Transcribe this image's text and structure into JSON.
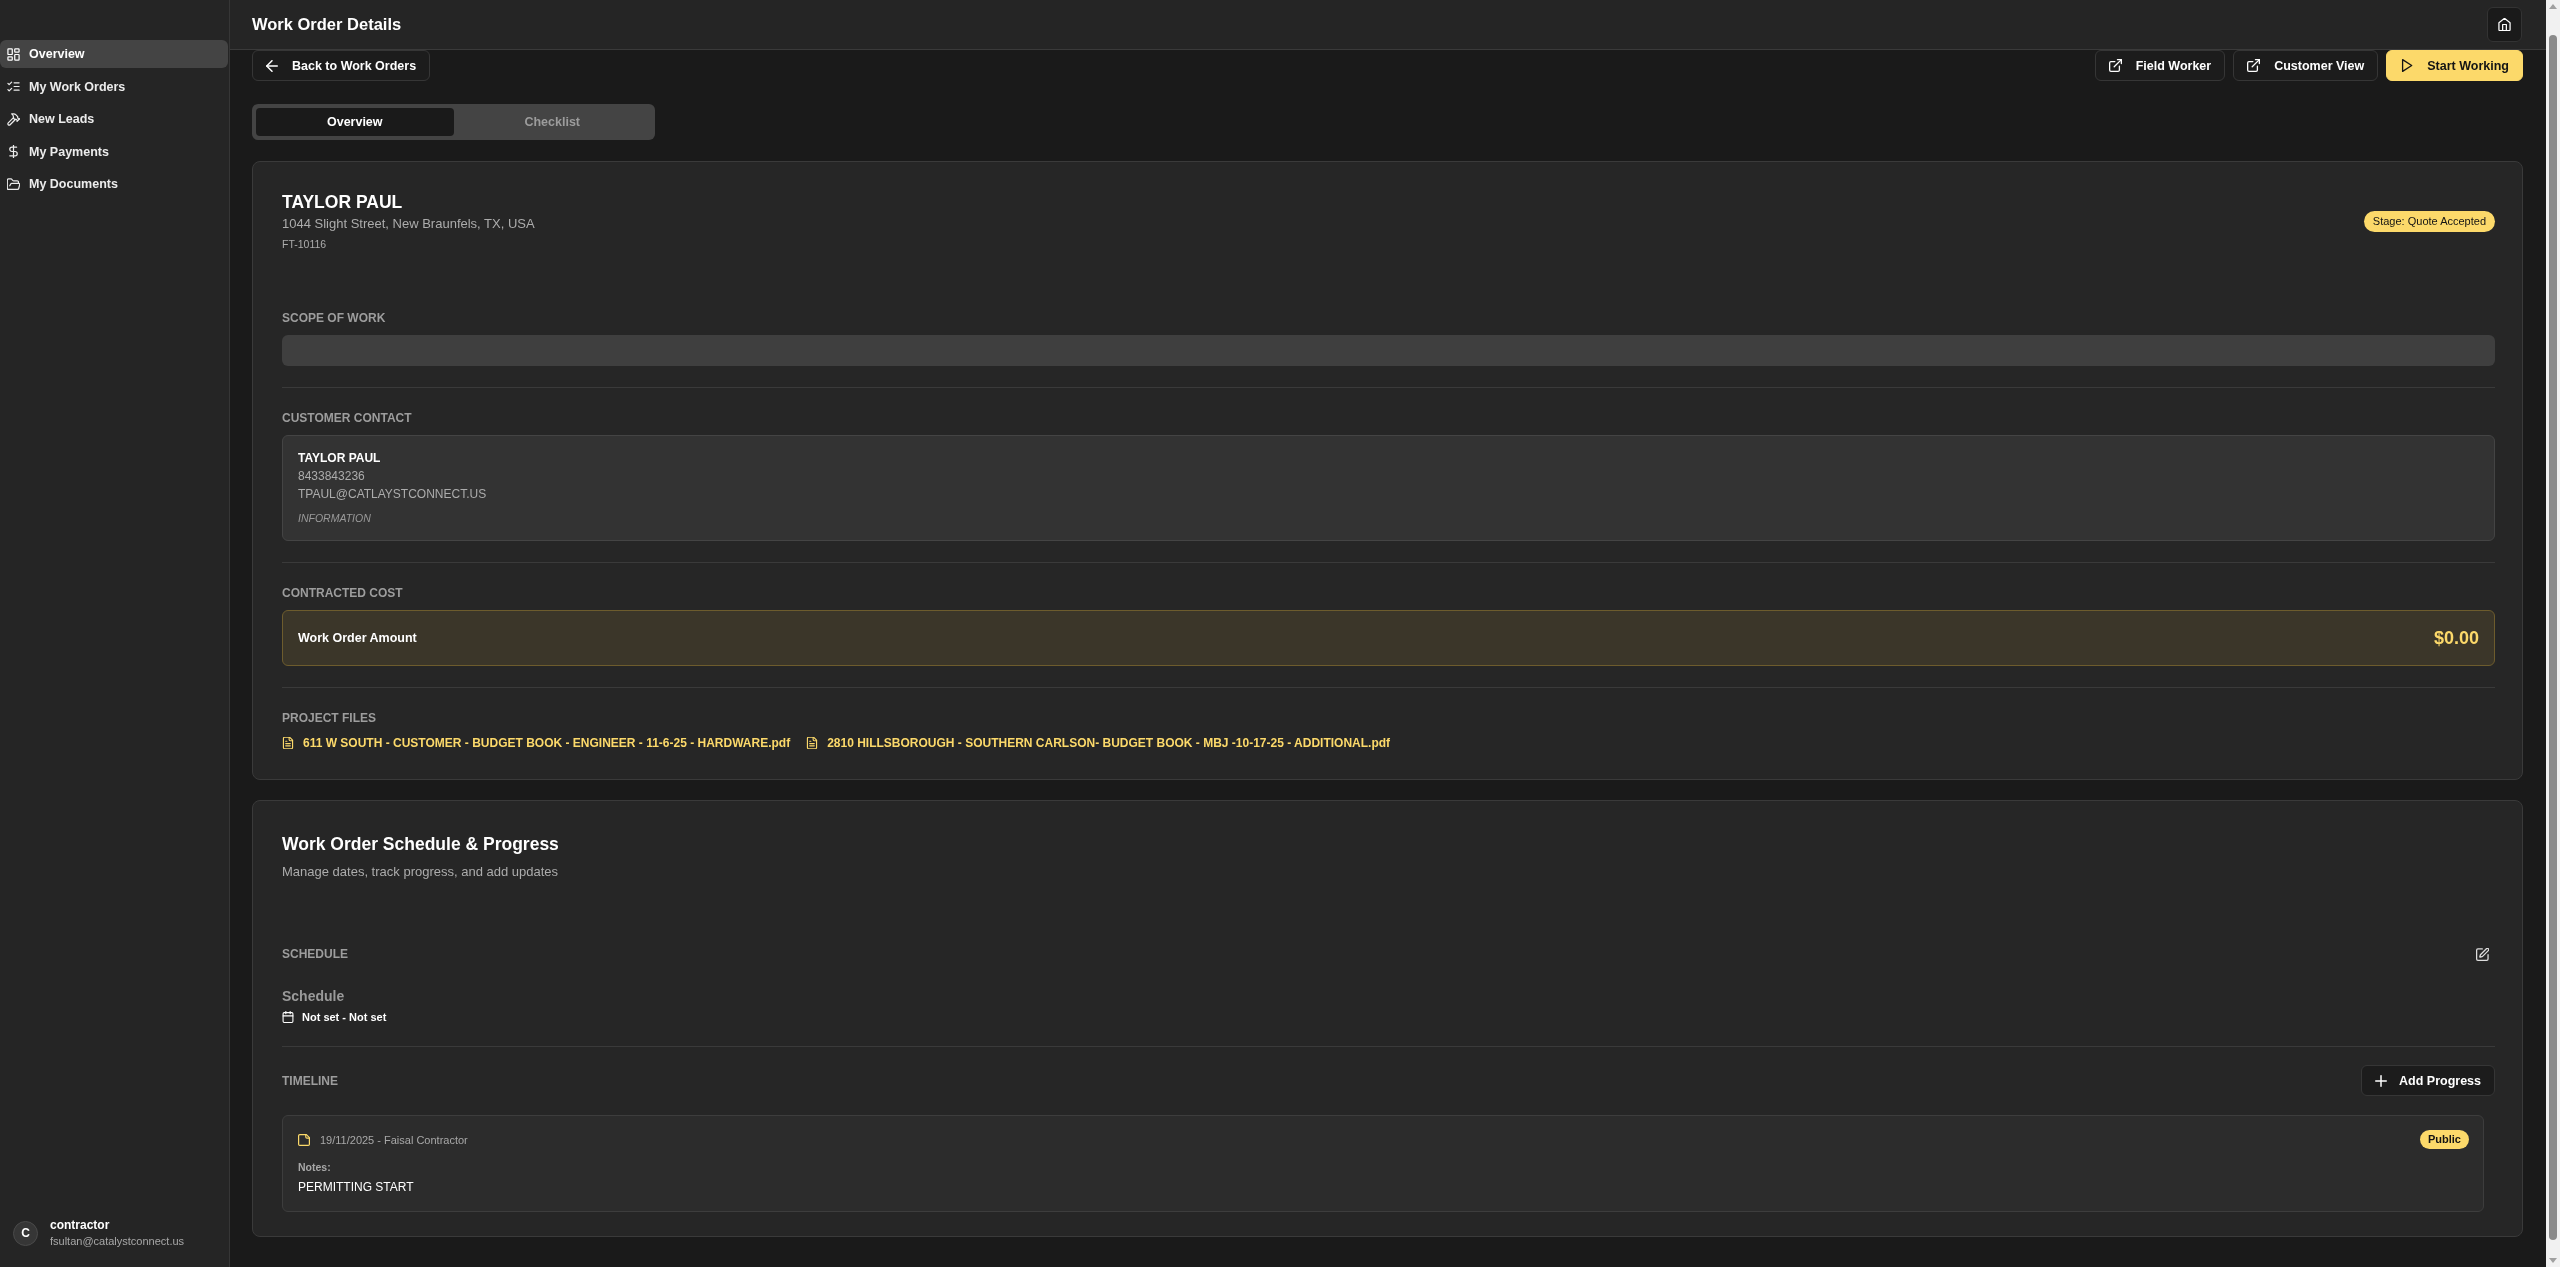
{
  "sidebar": {
    "items": [
      {
        "label": "Overview",
        "selected": true
      },
      {
        "label": "My Work Orders",
        "selected": false
      },
      {
        "label": "New Leads",
        "selected": false
      },
      {
        "label": "My Payments",
        "selected": false
      },
      {
        "label": "My Documents",
        "selected": false
      }
    ],
    "user": {
      "initial": "C",
      "name": "contractor",
      "email": "fsultan@catalystconnect.us"
    }
  },
  "header": {
    "title": "Work Order Details"
  },
  "toolbar": {
    "back_button": "Back to Work Orders",
    "actions": [
      {
        "label": "Field Worker",
        "kind": "outline"
      },
      {
        "label": "Customer View",
        "kind": "outline"
      },
      {
        "label": "Start Working",
        "kind": "primary"
      }
    ]
  },
  "tabs": [
    {
      "label": "Overview",
      "selected": true
    },
    {
      "label": "Checklist",
      "selected": false
    }
  ],
  "work_order": {
    "customer_name": "TAYLOR PAUL",
    "address": "1044 Slight Street, New Braunfels, TX, USA",
    "number": "FT-10116",
    "stage_badge": "Stage: Quote Accepted",
    "scope_of_work": {
      "label": "SCOPE OF WORK"
    },
    "customer_contact": {
      "label": "CUSTOMER CONTACT",
      "name": "TAYLOR PAUL",
      "phone": "8433843236",
      "email": "TPAUL@CATLAYSTCONNECT.US",
      "note": "INFORMATION"
    },
    "contracted_cost": {
      "label": "CONTRACTED COST",
      "item": "Work Order Amount",
      "amount": "$0.00"
    },
    "project_files": {
      "label": "PROJECT FILES",
      "files": [
        "611 W SOUTH - CUSTOMER - BUDGET BOOK - ENGINEER - 11-6-25 - HARDWARE.pdf",
        "2810 HILLSBOROUGH - SOUTHERN CARLSON- BUDGET BOOK - MBJ -10-17-25 - ADDITIONAL.pdf"
      ]
    }
  },
  "schedule_progress": {
    "title": "Work Order Schedule & Progress",
    "subtitle": "Manage dates, track progress, and add updates",
    "schedule": {
      "label": "SCHEDULE",
      "heading": "Schedule",
      "dates": "Not set - Not set"
    },
    "timeline": {
      "label": "TIMELINE",
      "add_button": "Add Progress",
      "entries": [
        {
          "meta": "19/11/2025 - Faisal Contractor",
          "visibility": "Public",
          "notes_label": "Notes:",
          "notes": "PERMITTING START"
        }
      ]
    }
  }
}
